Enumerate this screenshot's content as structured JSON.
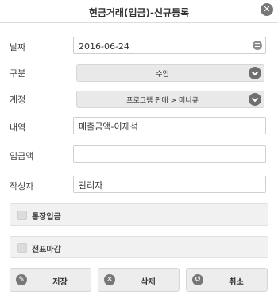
{
  "dialog": {
    "title": "현금거래(입금)-신규등록",
    "close_icon": "close-circle-icon"
  },
  "form": {
    "date": {
      "label": "날짜",
      "value": "2016-06-24",
      "icon": "calendar-icon"
    },
    "category": {
      "label": "구분",
      "selected": "수입"
    },
    "account": {
      "label": "계정",
      "selected": "프로그램 판매 > 머니큐"
    },
    "description": {
      "label": "내역",
      "value": "매출금액-이재석"
    },
    "amount": {
      "label": "입금액",
      "value": ""
    },
    "author": {
      "label": "작성자",
      "value": "관리자"
    }
  },
  "checks": {
    "bank_deposit": {
      "label": "통장입금",
      "checked": false
    },
    "slip_close": {
      "label": "전표마감",
      "checked": false
    }
  },
  "buttons": {
    "save": {
      "label": "저장",
      "icon": "pencil-icon"
    },
    "delete": {
      "label": "삭제",
      "icon": "x-circle-icon"
    },
    "cancel": {
      "label": "취소",
      "icon": "undo-icon"
    }
  }
}
